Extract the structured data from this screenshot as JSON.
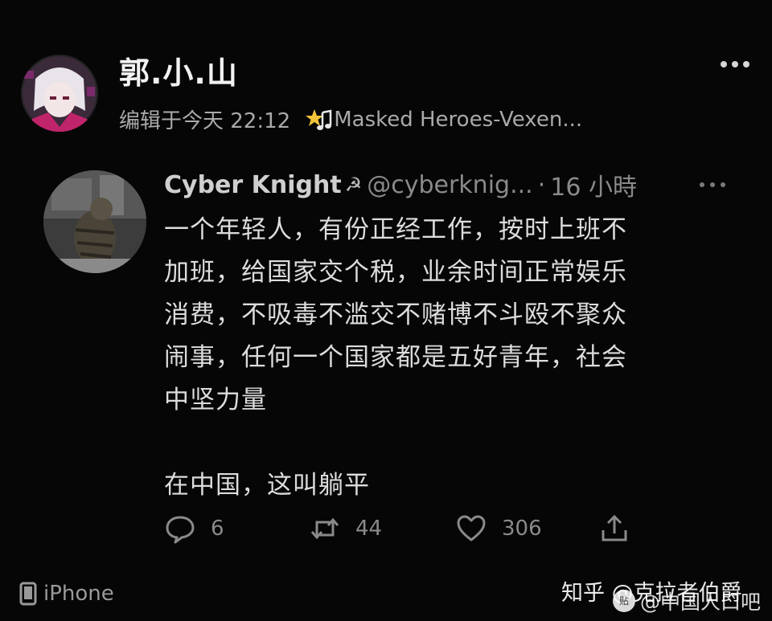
{
  "post": {
    "author_name": "郭.小.山",
    "meta": "编辑于今天 22:12",
    "music_text": "Masked Heroes-Vexen..."
  },
  "quote": {
    "name": "Cyber Knight",
    "sickle": "☭",
    "handle": "@cyberknig...",
    "dot": "·",
    "time": "16 小時",
    "lines": [
      "一个年轻人，有份正经工作，按时上班不",
      "加班，给国家交个税，业余时间正常娱乐",
      "消费，不吸毒不滥交不赌博不斗殴不聚众",
      "闹事，任何一个国家都是五好青年，社会",
      "中坚力量"
    ],
    "last_line": "在中国，这叫躺平"
  },
  "actions": {
    "reply_count": "6",
    "retweet_count": "44",
    "like_count": "306"
  },
  "footer": {
    "device": "iPhone",
    "watermark_zhihu": "知乎 @克拉者伯爵",
    "watermark_tieba_logo": "贴",
    "watermark_tieba": "@中国人口吧"
  },
  "colors": {
    "background": "#060606",
    "text_primary": "#e9e9e9",
    "text_secondary": "#8a8a8a"
  },
  "icons": [
    "more-icon",
    "music-icon",
    "reply-icon",
    "retweet-icon",
    "like-icon",
    "share-icon",
    "phone-icon"
  ]
}
